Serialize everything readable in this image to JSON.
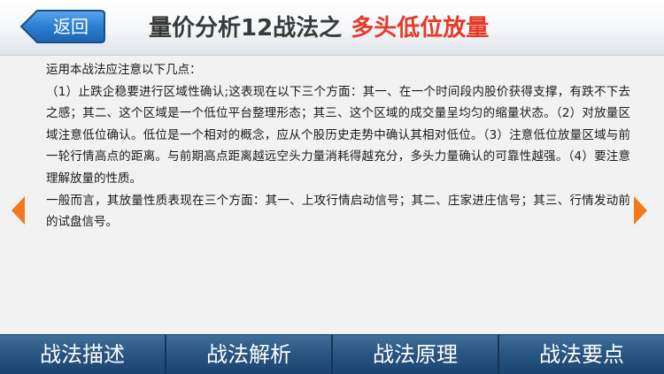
{
  "header": {
    "back_label": "返回",
    "title_main": "量价分析12战法之",
    "title_highlight": "多头低位放量"
  },
  "content": {
    "paragraphs": [
      "运用本战法应注意以下几点：",
      "（1）止跌企稳要进行区域性确认;这表现在以下三个方面：其一、在一个时间段内股价获得支撑，有跌不下去之感；其二、这个区域是一个低位平台整理形态；其三、这个区域的成交量呈均匀的缩量状态。（2）对放量区域注意低位确认。低位是一个相对的概念，应从个股历史走势中确认其相对低位。（3）注意低位放量区域与前一轮行情高点的距离。与前期高点距离越远空头力量消耗得越充分，多头力量确认的可靠性越强。（4）要注意理解放量的性质。",
      "一般而言，其放量性质表现在三个方面：其一、上攻行情启动信号；其二、庄家进庄信号；其三、行情发动前的试盘信号。"
    ]
  },
  "nav": {
    "prev_icon": "chevron-left-icon",
    "next_icon": "chevron-right-icon",
    "arrow_color": "#f07a1e"
  },
  "tabs": [
    {
      "label": "战法描述"
    },
    {
      "label": "战法解析"
    },
    {
      "label": "战法原理"
    },
    {
      "label": "战法要点"
    }
  ],
  "colors": {
    "back_button": "#2a78c8",
    "title_highlight": "#e53a2a",
    "tabbar": "#2a5683"
  }
}
